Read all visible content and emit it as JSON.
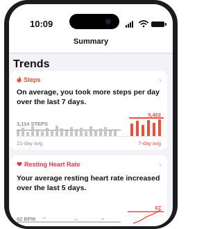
{
  "status_bar": {
    "time": "10:09"
  },
  "nav": {
    "title": "Summary"
  },
  "section": {
    "title": "Trends"
  },
  "steps_card": {
    "title": "Steps",
    "icon": "flame-icon",
    "accent": "#f24b3b",
    "description": "On average, you took more steps per day over the last 7 days.",
    "avg_21": "3,114 STEPS",
    "avg_7": "5,422",
    "footer_left": "21-day avg",
    "footer_right": "7-day avg"
  },
  "heart_card": {
    "title": "Resting Heart Rate",
    "icon": "heart-icon",
    "accent": "#e8354b",
    "description": "Your average resting heart rate increased over the last 5 days.",
    "avg_left": "62 BPM",
    "avg_right": "67"
  }
}
